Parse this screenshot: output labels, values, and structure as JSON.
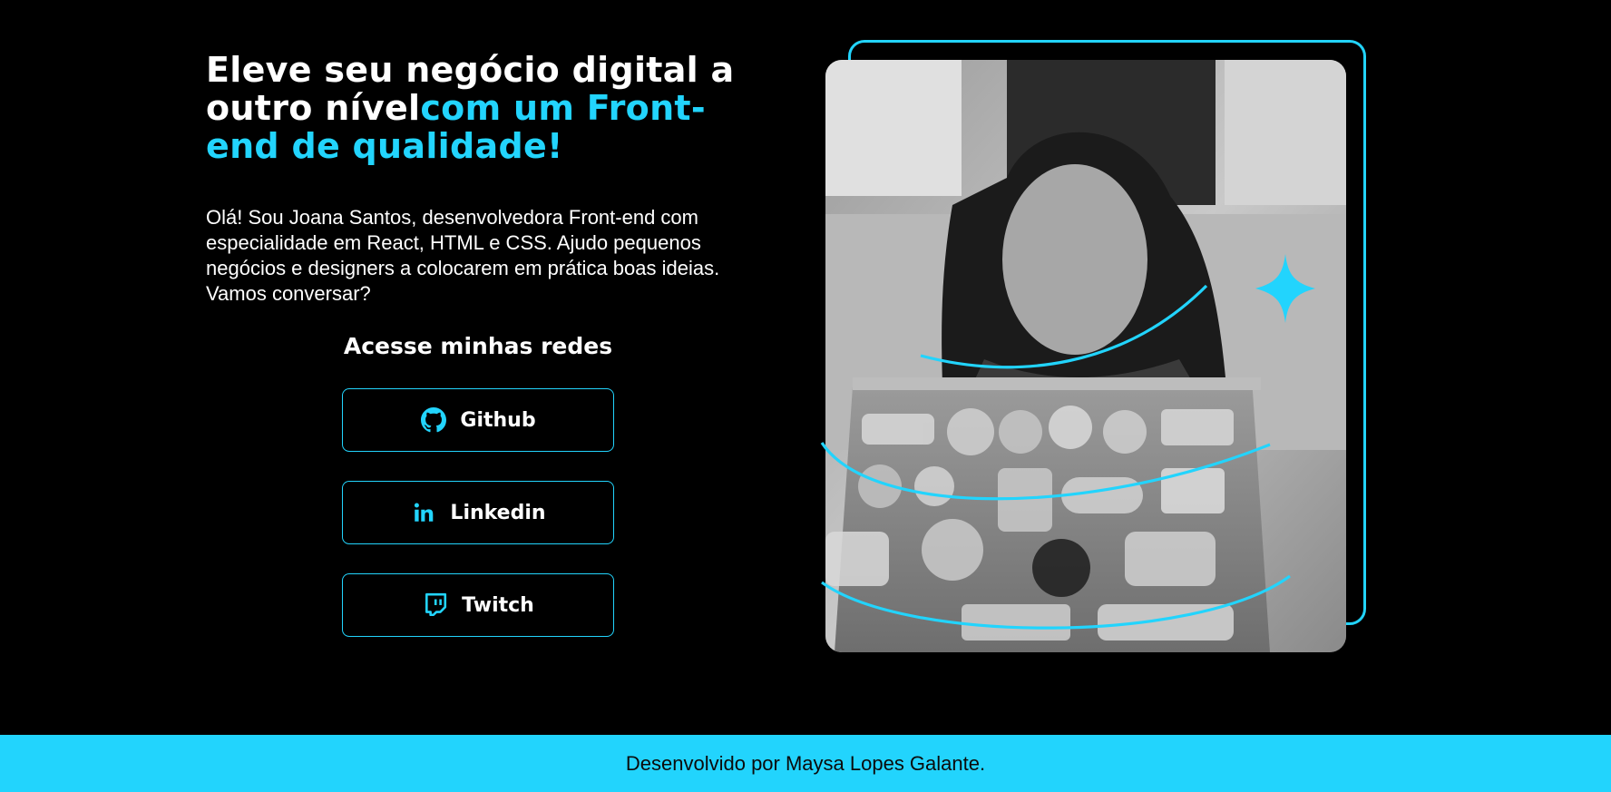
{
  "hero": {
    "headline_white": "Eleve seu negócio digital a outro nível",
    "headline_accent": "com um Front-end de qualidade!",
    "intro": "Olá! Sou Joana Santos, desenvolvedora Front-end com especialidade em React, HTML e CSS. Ajudo pequenos negócios e designers a colocarem em prática boas ideias. Vamos conversar?"
  },
  "socials": {
    "title": "Acesse minhas redes",
    "items": [
      {
        "label": "Github",
        "icon": "github-icon"
      },
      {
        "label": "Linkedin",
        "icon": "linkedin-icon"
      },
      {
        "label": "Twitch",
        "icon": "twitch-icon"
      }
    ]
  },
  "footer": {
    "text": "Desenvolvido por Maysa Lopes Galante."
  },
  "colors": {
    "background": "#000000",
    "accent": "#22d4fd",
    "text": "#ffffff",
    "footer_text": "#0b0b0b"
  }
}
